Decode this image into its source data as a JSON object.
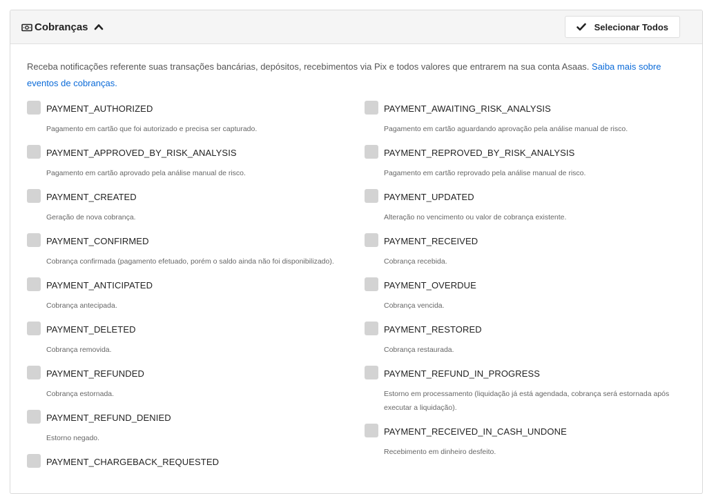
{
  "header": {
    "title": "Cobranças",
    "icon": "money-icon",
    "toggle_icon": "chevron-up-icon",
    "select_all_label": "Selecionar Todos"
  },
  "intro": {
    "text": "Receba notificações referente suas transações bancárias, depósitos, recebimentos via Pix e todos valores que entrarem na sua conta Asaas. ",
    "link": "Saiba mais sobre eventos de cobranças."
  },
  "colors": {
    "link": "#0a6ad8",
    "checkbox": "#d3d3d3",
    "header_bg": "#f5f5f5"
  },
  "events_left": [
    {
      "name": "PAYMENT_AUTHORIZED",
      "desc": "Pagamento em cartão que foi autorizado e precisa ser capturado."
    },
    {
      "name": "PAYMENT_APPROVED_BY_RISK_ANALYSIS",
      "desc": "Pagamento em cartão aprovado pela análise manual de risco."
    },
    {
      "name": "PAYMENT_CREATED",
      "desc": "Geração de nova cobrança."
    },
    {
      "name": "PAYMENT_CONFIRMED",
      "desc": "Cobrança confirmada (pagamento efetuado, porém o saldo ainda não foi disponibilizado)."
    },
    {
      "name": "PAYMENT_ANTICIPATED",
      "desc": "Cobrança antecipada."
    },
    {
      "name": "PAYMENT_DELETED",
      "desc": "Cobrança removida."
    },
    {
      "name": "PAYMENT_REFUNDED",
      "desc": "Cobrança estornada."
    },
    {
      "name": "PAYMENT_REFUND_DENIED",
      "desc": "Estorno negado."
    },
    {
      "name": "PAYMENT_CHARGEBACK_REQUESTED",
      "desc": ""
    }
  ],
  "events_right": [
    {
      "name": "PAYMENT_AWAITING_RISK_ANALYSIS",
      "desc": "Pagamento em cartão aguardando aprovação pela análise manual de risco."
    },
    {
      "name": "PAYMENT_REPROVED_BY_RISK_ANALYSIS",
      "desc": "Pagamento em cartão reprovado pela análise manual de risco."
    },
    {
      "name": "PAYMENT_UPDATED",
      "desc": "Alteração no vencimento ou valor de cobrança existente."
    },
    {
      "name": "PAYMENT_RECEIVED",
      "desc": "Cobrança recebida."
    },
    {
      "name": "PAYMENT_OVERDUE",
      "desc": "Cobrança vencida."
    },
    {
      "name": "PAYMENT_RESTORED",
      "desc": "Cobrança restaurada."
    },
    {
      "name": "PAYMENT_REFUND_IN_PROGRESS",
      "desc": "Estorno em processamento (liquidação já está agendada, cobrança será estornada após executar a liquidação)."
    },
    {
      "name": "PAYMENT_RECEIVED_IN_CASH_UNDONE",
      "desc": "Recebimento em dinheiro desfeito."
    }
  ]
}
